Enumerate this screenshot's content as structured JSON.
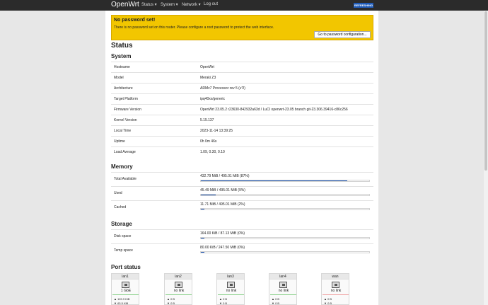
{
  "topbar": {
    "brand": "OpenWrt",
    "menu": [
      "Status ▾",
      "System ▾",
      "Network ▾",
      "Log out"
    ],
    "refresh": "REFRESHING"
  },
  "alert": {
    "title": "No password set!",
    "text": "There is no password set on this router. Please configure a root password to protect the web interface.",
    "button": "Go to password configuration..."
  },
  "page": {
    "title": "Status"
  },
  "system": {
    "title": "System",
    "rows": [
      {
        "label": "Hostname",
        "value": "OpenWrt"
      },
      {
        "label": "Model",
        "value": "Meraki Z3"
      },
      {
        "label": "Architecture",
        "value": "ARMv7 Processor rev 5 (v7l)"
      },
      {
        "label": "Target Platform",
        "value": "ipq40xx/generic"
      },
      {
        "label": "Firmware Version",
        "value": "OpenWrt 23.05.2 r23630-842932a63d / LuCI openwrt-23.05 branch git-23.306.39416-c86c256"
      },
      {
        "label": "Kernel Version",
        "value": "5.15.137"
      },
      {
        "label": "Local Time",
        "value": "2023-11-14 13:39:25"
      },
      {
        "label": "Uptime",
        "value": "0h 0m 46s"
      },
      {
        "label": "Load Average",
        "value": "1.09, 0.30, 0.10"
      }
    ]
  },
  "memory": {
    "title": "Memory",
    "rows": [
      {
        "label": "Total Available",
        "value": "432.79 MiB / 495.01 MiB (87%)",
        "percent": 87
      },
      {
        "label": "Used",
        "value": "45.49 MiB / 495.01 MiB (9%)",
        "percent": 9
      },
      {
        "label": "Cached",
        "value": "11.71 MiB / 495.01 MiB (2%)",
        "percent": 2
      }
    ]
  },
  "storage": {
    "title": "Storage",
    "rows": [
      {
        "label": "Disk space",
        "value": "164.00 KiB / 87.13 MiB (0%)",
        "percent": 0
      },
      {
        "label": "Temp space",
        "value": "80.00 KiB / 247.50 MiB (0%)",
        "percent": 0
      }
    ]
  },
  "ports": {
    "title": "Port status",
    "items": [
      {
        "name": "lan1",
        "status": "1 GbE",
        "rx": "▲ 109.9 KiB",
        "tx": "▼ 63.5 KiB",
        "color": "#87d087"
      },
      {
        "name": "lan2",
        "status": "no link",
        "rx": "▲ 0 B",
        "tx": "▼ 0 B",
        "color": "#87d087"
      },
      {
        "name": "lan3",
        "status": "no link",
        "rx": "▲ 0 B",
        "tx": "▼ 0 B",
        "color": "#87d087"
      },
      {
        "name": "lan4",
        "status": "no link",
        "rx": "▲ 0 B",
        "tx": "▼ 0 B",
        "color": "#87d087"
      },
      {
        "name": "wan",
        "status": "no link",
        "rx": "▲ 0 B",
        "tx": "▼ 0 B",
        "color": "#f0a0a0"
      }
    ]
  }
}
